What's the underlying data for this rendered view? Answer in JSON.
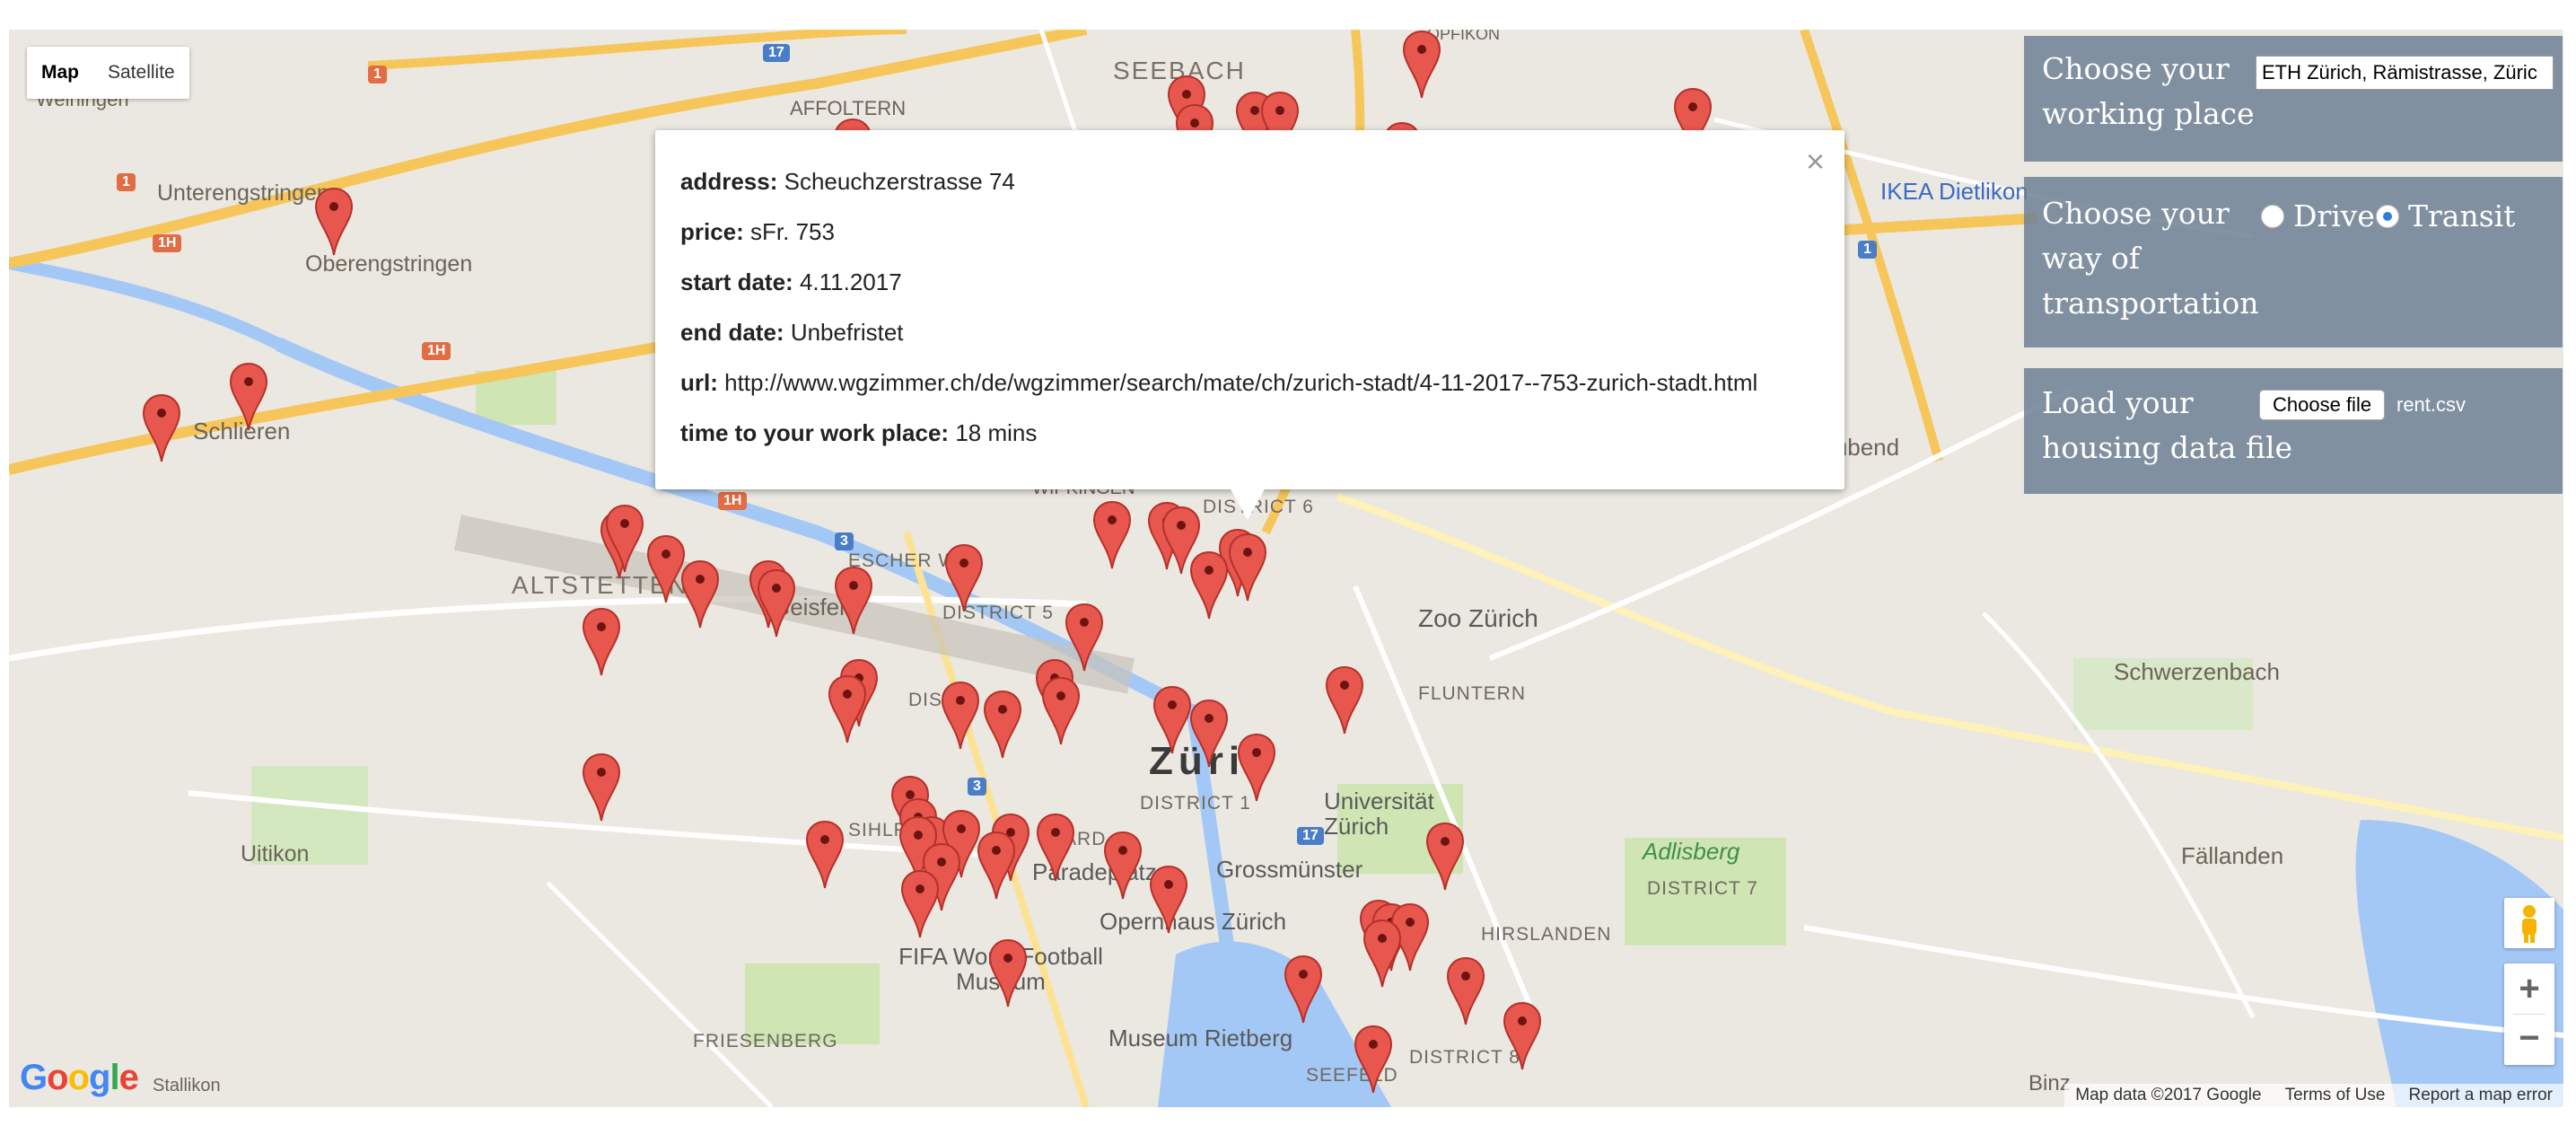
{
  "map_type": {
    "map_label": "Map",
    "satellite_label": "Satellite",
    "active": "Map"
  },
  "place_labels": {
    "seebach": "SEEBACH",
    "affoltern": "AFFOLTERN",
    "weiningen": "Weiningen",
    "unterengstringen": "Unterengstringen",
    "oberengstringen": "Oberengstringen",
    "schlieren": "Schlieren",
    "altstetten": "ALTSTETTEN",
    "escher_wyss": "ESCHER WY",
    "district5": "DISTRICT 5",
    "district6": "DISTRICT 6",
    "district1": "DISTRICT 1",
    "district7": "DISTRICT 7",
    "district8": "DISTRICT 8",
    "zurich": "Züric",
    "uitikon": "Uitikon",
    "friesenberg": "FRIESENBERG",
    "fluntern": "FLUNTERN",
    "hirslanden": "HIRSLANDEN",
    "seefeld": "SEEFELD",
    "zoo": "Zoo Zürich",
    "universitat": "Universität Zürich",
    "grossmunster": "Grossmünster",
    "opernhaus": "Opernhaus Zürich",
    "paradeplatz": "Paradeplatz",
    "fifa": "FIFA World Football Museum",
    "rietberg": "Museum Rietberg",
    "adlisberg": "Adlisberg",
    "schwerzenbach": "Schwerzenbach",
    "fallanden": "Fällanden",
    "dubendorf": "Dübend",
    "ikea": "IKEA Dietlikon",
    "binz": "Binz",
    "hardbrucke": "WIPKINGEN",
    "dist": "DIST",
    "sihlf": "SIHLF",
    "ward": "WARD",
    "geisfeld": "Geisfeld",
    "opfikon": "OPFIKON",
    "stallikon": "Stallikon"
  },
  "info_window": {
    "address_label": "address:",
    "address": "Scheuchzerstrasse 74",
    "price_label": "price:",
    "price": "sFr. 753",
    "start_label": "start date:",
    "start": "4.11.2017",
    "end_label": "end date:",
    "end": "Unbefristet",
    "url_label": "url:",
    "url": "http://www.wgzimmer.ch/de/wgzimmer/search/mate/ch/zurich-stadt/4-11-2017--753-zurich-stadt.html",
    "time_label": "time to your work place:",
    "time": "18 mins",
    "close": "×"
  },
  "panel": {
    "work_title_1": "Choose your",
    "work_title_2": "working place",
    "work_value": "ETH Zürich, Rämistrasse, Züric",
    "transport_title_1": "Choose your",
    "transport_title_2": "way of",
    "transport_title_3": "transportation",
    "drive_label": "Drive",
    "transit_label": "Transit",
    "selected": "Transit",
    "load_title_1": "Load your",
    "load_title_2": "housing data file",
    "file_button": "Choose file",
    "file_name": "rent.csv"
  },
  "footer": {
    "map_data": "Map data ©2017 Google",
    "terms": "Terms of Use",
    "report": "Report a map error"
  },
  "google_logo": "Google",
  "colors": {
    "marker": "#e8574e",
    "land": "#ebe8e1",
    "water": "#a4c8f5",
    "park": "#cfe5b4",
    "highway": "#f6c65b",
    "panel": "#6f8094"
  },
  "markers_count": 77,
  "icons": [
    "marker-pin",
    "pegman-icon",
    "zoom-in-icon",
    "zoom-out-icon",
    "close-icon"
  ]
}
